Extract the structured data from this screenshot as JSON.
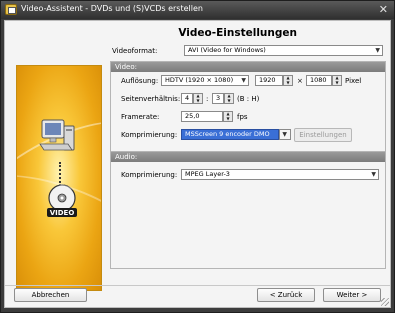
{
  "window": {
    "title": "Video-Assistent - DVDs und (S)VCDs erstellen",
    "close_glyph": "✕"
  },
  "banner": {
    "disc_label": "VIDEO"
  },
  "page": {
    "title": "Video-Einstellungen"
  },
  "videoformat": {
    "label": "Videoformat:",
    "value": "AVI (Video for Windows)"
  },
  "video": {
    "header": "Video:",
    "resolution_label": "Auflösung:",
    "resolution_value": "HDTV (1920 × 1080)",
    "width": "1920",
    "times": "×",
    "height": "1080",
    "pixel_label": "Pixel",
    "aspect_label": "Seitenverhältnis:",
    "aspect_b": "4",
    "colon": ":",
    "aspect_h": "3",
    "aspect_hint": "(B : H)",
    "framerate_label": "Framerate:",
    "framerate_value": "25,0",
    "fps_label": "fps",
    "compression_label": "Komprimierung:",
    "compression_value": "MSScreen 9 encoder DMO",
    "settings_button": "Einstellungen"
  },
  "audio": {
    "header": "Audio:",
    "compression_label": "Komprimierung:",
    "compression_value": "MPEG Layer-3"
  },
  "footer": {
    "cancel": "Abbrechen",
    "back": "< Zurück",
    "next": "Weiter >"
  },
  "colors": {
    "selection": "#3a6fd6",
    "banner_gold": "#eba513",
    "group_header": "#8a8a8a"
  }
}
